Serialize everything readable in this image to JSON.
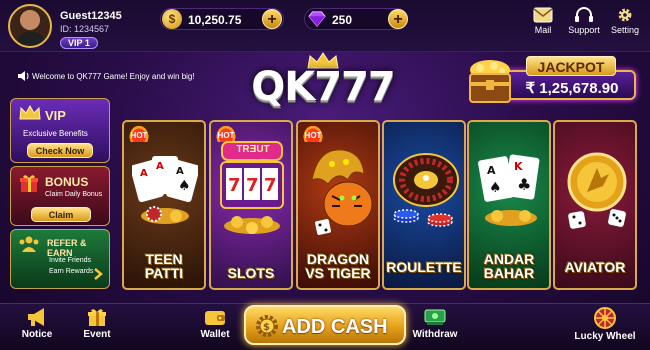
{
  "user": {
    "name": "Guest12345",
    "id": "ID: 1234567",
    "vip": "VIP 1"
  },
  "balance": {
    "coins": "10,250.75",
    "gems": "250"
  },
  "top_menu": [
    {
      "label": "Mail",
      "icon": "mail-icon"
    },
    {
      "label": "Support",
      "icon": "headset-icon"
    },
    {
      "label": "Setting",
      "icon": "gear-icon"
    }
  ],
  "announcement": "Welcome to QK777 Game! Enjoy and win big!",
  "logo": "QK777",
  "jackpot": {
    "title": "JACKPOT",
    "amount": "₹ 1,25,678.90"
  },
  "side_panels": {
    "vip": {
      "title": "VIP",
      "subtitle": "Exclusive Benefits",
      "button": "Check Now"
    },
    "bonus": {
      "title": "BONUS",
      "subtitle": "Claim Daily Bonus",
      "button": "Claim"
    },
    "refer": {
      "title": "REFER & EARN",
      "subtitle_1": "Invite Friends",
      "subtitle_2": "Earn Rewards"
    }
  },
  "games": [
    {
      "line1": "TEEN",
      "line2": "PATTI",
      "hot": "HOT"
    },
    {
      "line1": "SLOTS",
      "line2": "",
      "hot": "HOT",
      "sign": "TRƎUT"
    },
    {
      "line1": "DRAGON",
      "line2": "VS TIGER",
      "hot": "HOT"
    },
    {
      "line1": "ROULETTE",
      "line2": ""
    },
    {
      "line1": "ANDAR",
      "line2": "BAHAR"
    },
    {
      "line1": "AVIATOR",
      "line2": ""
    }
  ],
  "bottom_nav": [
    {
      "label": "Notice",
      "icon": "megaphone-icon"
    },
    {
      "label": "Event",
      "icon": "gift-icon"
    },
    {
      "label": "Wallet",
      "icon": "wallet-icon"
    },
    {
      "label": "Withdraw",
      "icon": "cash-icon"
    },
    {
      "label": "Lucky Wheel",
      "icon": "wheel-icon"
    }
  ],
  "add_cash": "ADD CASH",
  "colors": {
    "accent_gold": "#e6b84a",
    "bg_purple": "#2a0d4a",
    "jackpot_gold": "#ffe28a"
  }
}
